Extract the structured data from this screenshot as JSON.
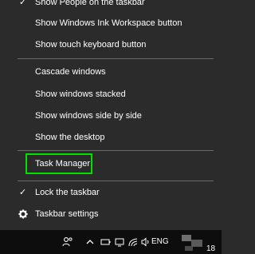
{
  "context_menu": {
    "top_partial": {
      "label": "Show People on the taskbar",
      "checked": true
    },
    "items_group1": [
      {
        "label": "Show Windows Ink Workspace button"
      },
      {
        "label": "Show touch keyboard button"
      }
    ],
    "items_group2": [
      {
        "label": "Cascade windows"
      },
      {
        "label": "Show windows stacked"
      },
      {
        "label": "Show windows side by side"
      },
      {
        "label": "Show the desktop"
      }
    ],
    "task_manager": {
      "label": "Task Manager",
      "highlight_color": "#00e100"
    },
    "lock_taskbar": {
      "label": "Lock the taskbar",
      "checked": true
    },
    "taskbar_settings": {
      "label": "Taskbar settings",
      "icon": "gear-icon"
    }
  },
  "taskbar": {
    "tray_icons": [
      "people-icon",
      "chevron-up-icon",
      "battery-icon",
      "network-icon",
      "wifi-icon",
      "volume-icon"
    ],
    "language": "ENG",
    "clock_partial": "18"
  },
  "colors": {
    "menu_bg": "#2b2b2b",
    "separator": "#6a6a6a",
    "taskbar_bg": "#0d0d0d",
    "text": "#ffffff"
  }
}
